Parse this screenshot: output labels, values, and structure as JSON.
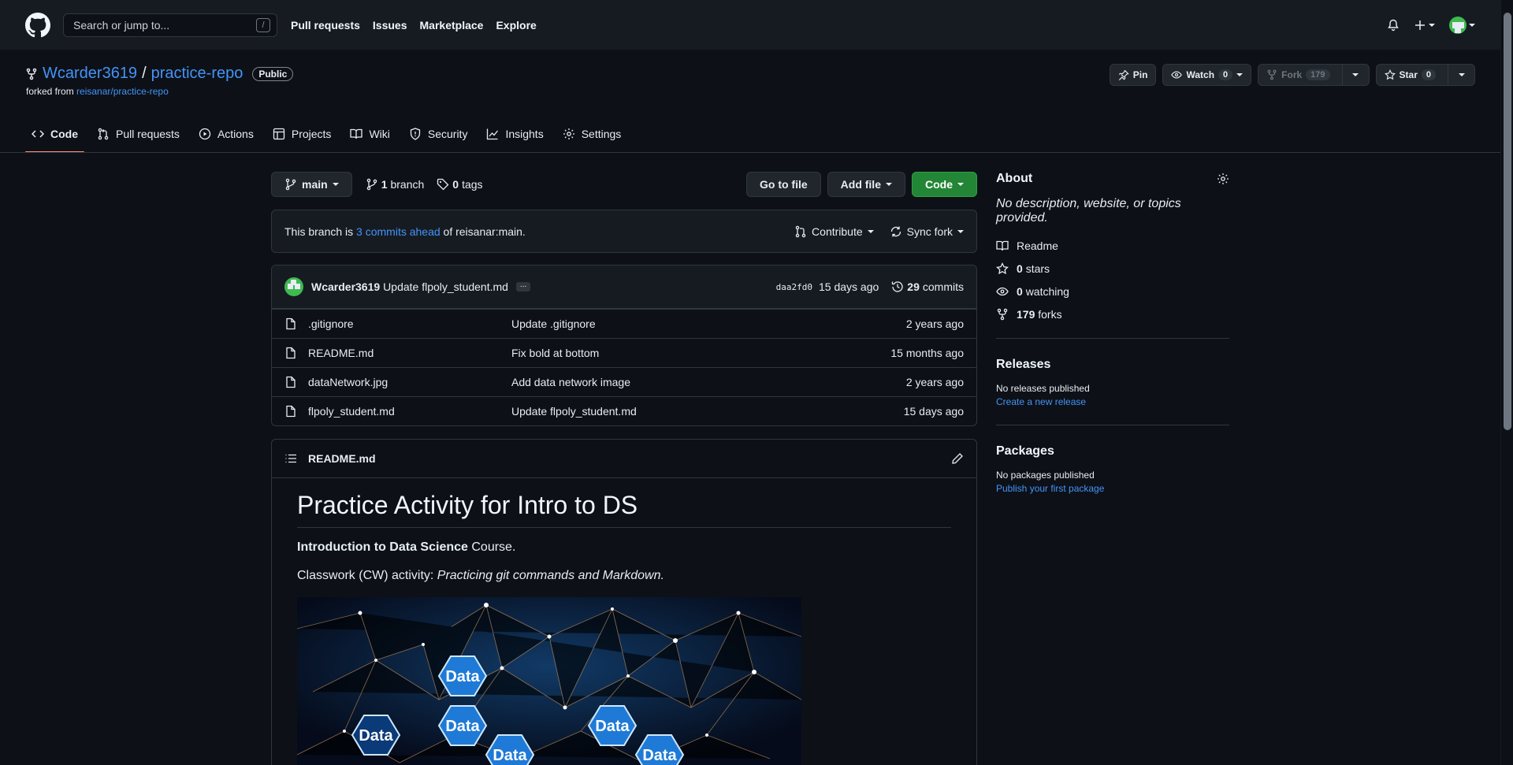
{
  "header": {
    "search_placeholder": "Search or jump to...",
    "search_shortcut": "/",
    "nav": [
      "Pull requests",
      "Issues",
      "Marketplace",
      "Explore"
    ]
  },
  "repo": {
    "owner": "Wcarder3619",
    "separator": "/",
    "name": "practice-repo",
    "visibility": "Public",
    "forked_prefix": "forked from ",
    "forked_from": "reisanar/practice-repo",
    "actions": {
      "pin": "Pin",
      "watch": "Watch",
      "watch_count": "0",
      "fork": "Fork",
      "fork_count": "179",
      "star": "Star",
      "star_count": "0"
    },
    "tabs": [
      "Code",
      "Pull requests",
      "Actions",
      "Projects",
      "Wiki",
      "Security",
      "Insights",
      "Settings"
    ],
    "active_tab": "Code"
  },
  "branchbar": {
    "branch": "main",
    "branches_count": "1",
    "branches_label": "branch",
    "tags_count": "0",
    "tags_label": "tags",
    "go_to_file": "Go to file",
    "add_file": "Add file",
    "code": "Code"
  },
  "ahead": {
    "prefix": "This branch is ",
    "link": "3 commits ahead",
    "suffix": " of reisanar:main.",
    "contribute": "Contribute",
    "sync": "Sync fork"
  },
  "commit": {
    "author": "Wcarder3619",
    "message": "Update flpoly_student.md",
    "ellipsis": "...",
    "sha": "daa2fd0",
    "time": "15 days ago",
    "count": "29",
    "count_label": "commits"
  },
  "files": [
    {
      "name": ".gitignore",
      "message": "Update .gitignore",
      "age": "2 years ago"
    },
    {
      "name": "README.md",
      "message": "Fix bold at bottom",
      "age": "15 months ago"
    },
    {
      "name": "dataNetwork.jpg",
      "message": "Add data network image",
      "age": "2 years ago"
    },
    {
      "name": "flpoly_student.md",
      "message": "Update flpoly_student.md",
      "age": "15 days ago"
    }
  ],
  "readme": {
    "filename": "README.md",
    "title": "Practice Activity for Intro to DS",
    "p1_bold": "Introduction to Data Science",
    "p1_rest": " Course.",
    "p2_prefix": "Classwork (CW) activity: ",
    "p2_italic": "Practicing git commands and Markdown.",
    "image_labels": [
      "Data",
      "Data",
      "Data",
      "Data",
      "Data",
      "Data"
    ]
  },
  "about": {
    "title": "About",
    "description": "No description, website, or topics provided.",
    "readme": "Readme",
    "stars_count": "0",
    "stars_label": "stars",
    "watching_count": "0",
    "watching_label": "watching",
    "forks_count": "179",
    "forks_label": "forks"
  },
  "releases": {
    "title": "Releases",
    "none": "No releases published",
    "link": "Create a new release"
  },
  "packages": {
    "title": "Packages",
    "none": "No packages published",
    "link": "Publish your first package"
  },
  "colors": {
    "background": "#0d1117",
    "header": "#161b22",
    "accent_link": "#4493f8",
    "code_button": "#238636",
    "active_tab_underline": "#fd8c73"
  }
}
